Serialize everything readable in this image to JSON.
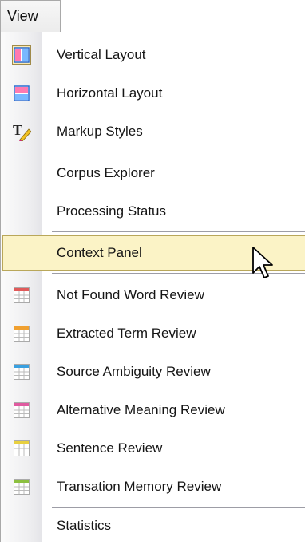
{
  "menubar": {
    "view_accel": "V",
    "view_rest": "iew"
  },
  "menu": {
    "items": [
      {
        "label": "Vertical Layout",
        "icon": "vertical-layout-icon"
      },
      {
        "label": "Horizontal Layout",
        "icon": "horizontal-layout-icon"
      },
      {
        "label": "Markup Styles",
        "icon": "markup-styles-icon"
      },
      {
        "label": "Corpus Explorer"
      },
      {
        "label": "Processing Status"
      },
      {
        "label": "Context Panel",
        "highlighted": true
      },
      {
        "label": "Not Found Word Review",
        "icon": "table-icon",
        "accent": "#e05a5a"
      },
      {
        "label": "Extracted Term Review",
        "icon": "table-icon",
        "accent": "#f0a030"
      },
      {
        "label": "Source Ambiguity Review",
        "icon": "table-icon",
        "accent": "#3aa0e0"
      },
      {
        "label": "Alternative Meaning Review",
        "icon": "table-icon",
        "accent": "#e05aa0"
      },
      {
        "label": "Sentence Review",
        "icon": "table-icon",
        "accent": "#e8d040"
      },
      {
        "label": "Transation Memory Review",
        "icon": "table-icon",
        "accent": "#8cc040"
      },
      {
        "label": "Statistics"
      }
    ]
  },
  "colors": {
    "highlight": "#fbf3c6",
    "highlight_border": "#b9a75a",
    "gutter": "#eeeef0"
  }
}
